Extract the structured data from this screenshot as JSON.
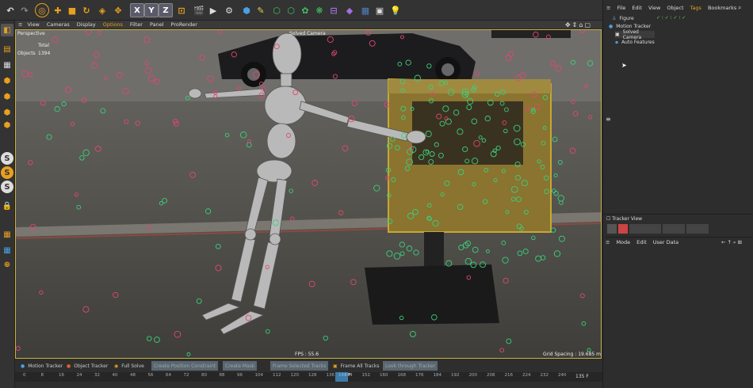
{
  "menu": {
    "items": [
      "View",
      "Cameras",
      "Display",
      "Options",
      "Filter",
      "Panel",
      "ProRender"
    ]
  },
  "viewport": {
    "label": "Perspective",
    "camera": "Solved Camera",
    "stats_header": "Total",
    "stats_label": "Objects",
    "stats_value": "1394",
    "fps": "FPS : 55.6",
    "grid": "Grid Spacing : 19.685 m"
  },
  "toolbar": {
    "x": "X",
    "y": "Y",
    "z": "Z"
  },
  "left": {
    "s": "S"
  },
  "timeline": {
    "buttons": [
      "Motion Tracker",
      "Object Tracker",
      "Full Solve",
      "Create Position Constraint",
      "Create Mask",
      "Frame Selected Tracks",
      "Frame All Tracks",
      "Look through Tracker"
    ],
    "ticks": [
      "0",
      "8",
      "16",
      "24",
      "32",
      "40",
      "48",
      "56",
      "64",
      "72",
      "80",
      "88",
      "96",
      "104",
      "112",
      "120",
      "128",
      "136",
      "144",
      "152",
      "160",
      "168",
      "176",
      "184",
      "192",
      "200",
      "208",
      "216",
      "224",
      "232",
      "240"
    ],
    "current": "144 F",
    "end": "135 F"
  },
  "right": {
    "menu": [
      "File",
      "Edit",
      "View",
      "Object",
      "Tags",
      "Bookmarks"
    ],
    "objects": [
      "Figure",
      "Motion Tracker",
      "Solved Camera",
      "Auto Features"
    ],
    "tracker_view": "Tracker View",
    "attr_menu": [
      "Mode",
      "Edit",
      "User Data"
    ]
  }
}
